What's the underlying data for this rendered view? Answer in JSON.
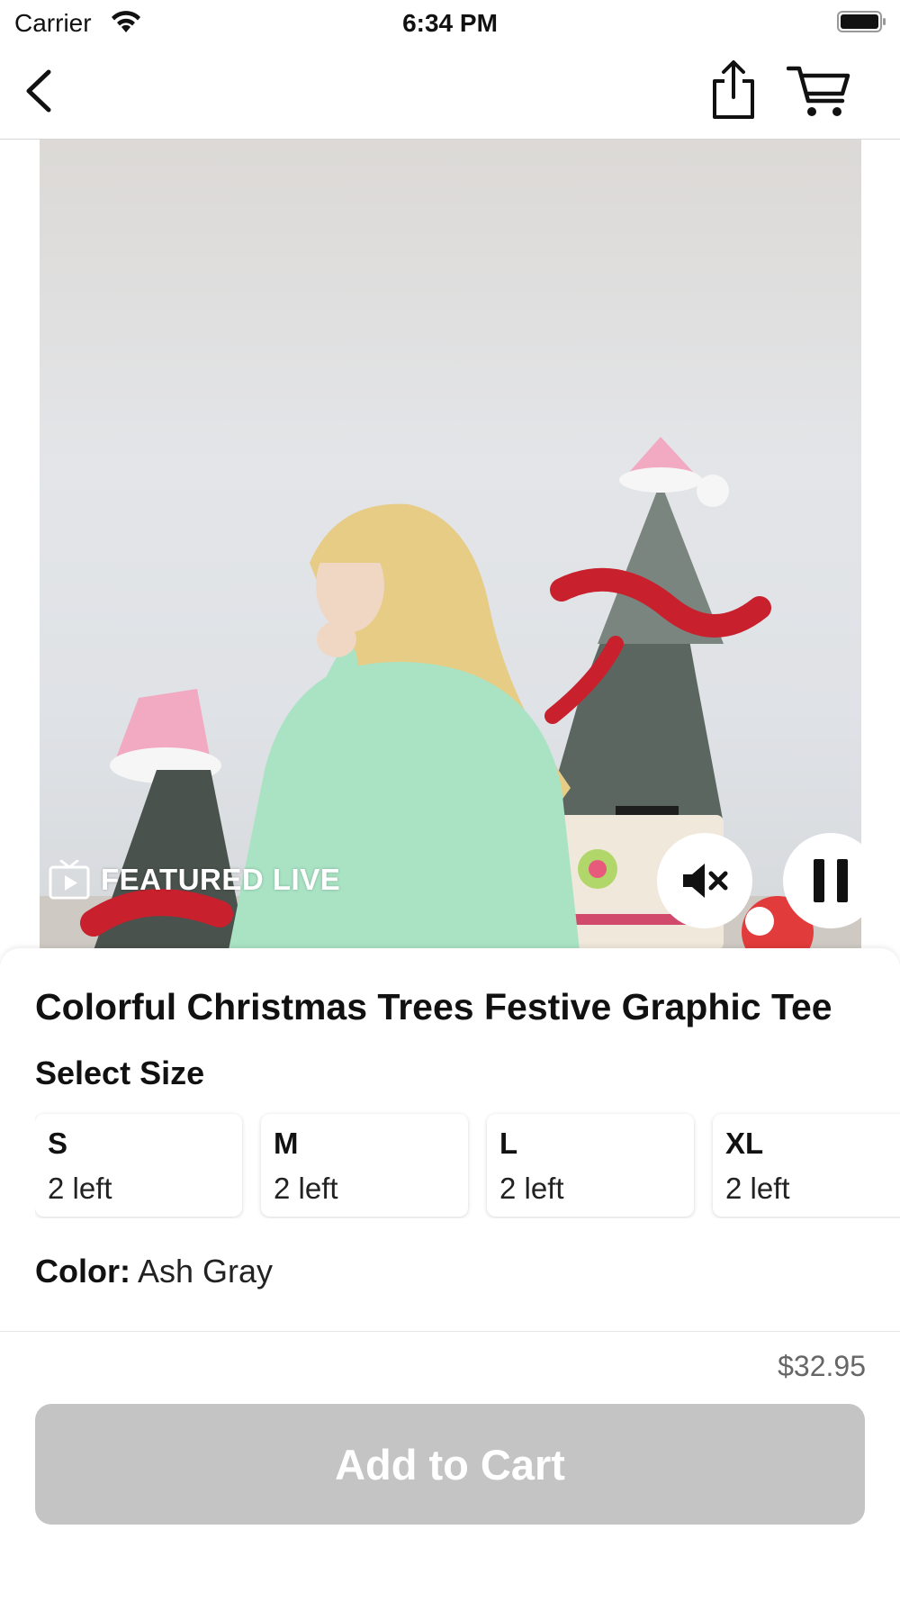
{
  "status_bar": {
    "carrier": "Carrier",
    "time": "6:34 PM"
  },
  "nav": {
    "back_icon": "chevron-left-icon",
    "share_icon": "share-icon",
    "cart_icon": "cart-icon"
  },
  "media": {
    "badge_label": "FEATURED LIVE",
    "badge_icon": "tv-icon",
    "mute_icon": "speaker-muted-icon",
    "pause_icon": "pause-icon"
  },
  "product": {
    "title": "Colorful Christmas Trees Festive Graphic Tee",
    "size_heading": "Select Size",
    "sizes": [
      {
        "name": "S",
        "stock": "2 left"
      },
      {
        "name": "M",
        "stock": "2 left"
      },
      {
        "name": "L",
        "stock": "2 left"
      },
      {
        "name": "XL",
        "stock": "2 left"
      }
    ],
    "color_label": "Color:",
    "color_value": "Ash Gray"
  },
  "footer": {
    "price": "$32.95",
    "add_to_cart_label": "Add to Cart"
  },
  "colors": {
    "button_disabled": "#c4c4c4",
    "price_text": "#666666"
  }
}
